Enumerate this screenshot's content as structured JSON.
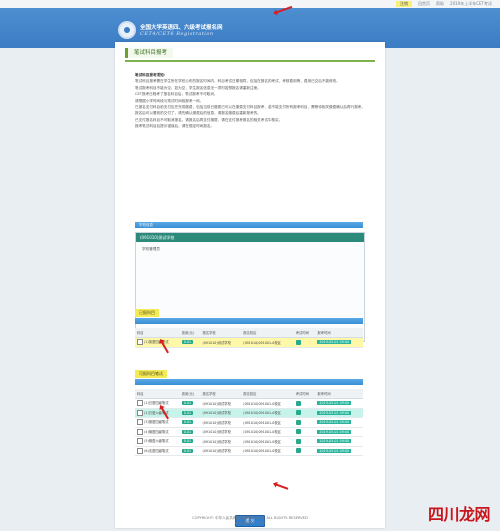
{
  "topbar": {
    "links": [
      "回首页",
      "帮助",
      "2019年上半年CET考试"
    ],
    "login_highlight": "注销"
  },
  "header": {
    "title": "全国大学英语四、六级考试报名网",
    "subtitle": "CET4/CET6 Registration"
  },
  "panel": {
    "title": "笔试科目报考"
  },
  "notice": {
    "heading": "笔试科目报考须知：",
    "lines": [
      "笔试科目报考需在学生所在学校公布的报名时间内，科目考试日期相同，包括在报名的考试、考核费用等，费用已交后不能修改。",
      "笔试报考科目不能为空，如为空，学生报名信息无一项时若想报名请重新注册。",
      "CET报考日程考了报名科目后，笔试报考不可取消。",
      "请根据小学时间段与笔试时间段报考一科。",
      "已报名支付科目前支付应先完成缴费，包括当前已缴费已可以在缴费支付科目报考，若不能支付所有报考科目，需等待相关缴费确认后再行报考。",
      "报名后可以看到的交付了，请先确认缴费后的信息，请报名缴费后重新报考的。",
      "已支付报名科目不可取消报名，请报名后再支付缴费，请在支付报考报名的相关考试中核实，",
      "报考笔试科目后提示错误后，请在规定时间报名。"
    ]
  },
  "school_section": {
    "bar_label": "学校信息",
    "school_name": "(091010)测试学校",
    "school_sub": "学校管理员"
  },
  "stage1": {
    "label": "已报科目",
    "headers": [
      "科目",
      "费用(元)",
      "报名学校",
      "报名校区",
      "考试时间",
      "报考时间"
    ],
    "rows": [
      {
        "subject": "(1)英语四级笔试",
        "fee": "0.01",
        "school": "(091010)测试学校",
        "campus": "(091010)091001-0校区",
        "date": "2019-05-01 09:00"
      }
    ]
  },
  "stage2": {
    "label": "可报科目笔试",
    "headers": [
      "科目",
      "费用(元)",
      "报名学校",
      "报名校区",
      "考试时间",
      "报考时间"
    ],
    "rows": [
      {
        "subject": "(1)日语四级笔试",
        "fee": "0.01",
        "school": "(091010)测试学校",
        "campus": "(091010)091001-0校区",
        "date": "2019-05-01 09:00"
      },
      {
        "subject": "(2)日语六级笔试",
        "fee": "0.01",
        "school": "(091010)测试学校",
        "campus": "(091010)091001-0校区",
        "date": "2019-05-01 09:00"
      },
      {
        "subject": "(3)德语四级笔试",
        "fee": "0.01",
        "school": "(091010)测试学校",
        "campus": "(091010)091001-0校区",
        "date": "2019-05-01 09:00"
      },
      {
        "subject": "(4)俄语四级笔试",
        "fee": "0.01",
        "school": "(091010)测试学校",
        "campus": "(091010)091001-0校区",
        "date": "2019-05-01 09:00"
      },
      {
        "subject": "(5)俄语六级笔试",
        "fee": "0.01",
        "school": "(091010)测试学校",
        "campus": "(091010)091001-0校区",
        "date": "2019-05-01 09:00"
      },
      {
        "subject": "(6)法语四级笔试",
        "fee": "0.01",
        "school": "(091010)测试学校",
        "campus": "(091010)091001-0校区",
        "date": "2019-05-01 09:00"
      }
    ]
  },
  "submit_label": "提 交",
  "footer": {
    "line1": "COPYRIGHT: 中华人民共和国教育部考试中心 ALL RIGHTS RESERVED",
    "line2": "京ICP备05031027"
  },
  "watermark": {
    "text": "四川龙网"
  },
  "colors": {
    "header": "#3b7cc4",
    "accent_green": "#27a98d",
    "highlight_yellow": "#f4ea55",
    "highlight_cyan": "#43d6b9",
    "arrow_red": "#d92020"
  }
}
